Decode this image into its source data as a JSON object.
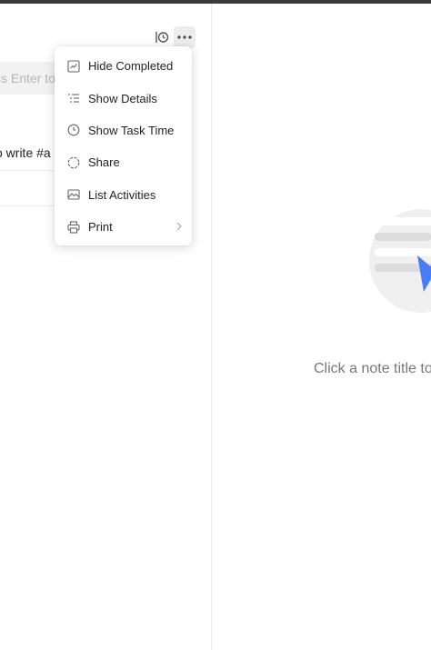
{
  "toolbar": {
    "focus_icon": "focus-clock-icon",
    "more_icon": "more-horizontal-icon"
  },
  "task_input": {
    "placeholder": "ss Enter to"
  },
  "tasks": [
    {
      "title": "o write #a"
    },
    {
      "title": ""
    }
  ],
  "menu": {
    "items": [
      {
        "label": "Hide Completed",
        "icon": "hide-completed-icon"
      },
      {
        "label": "Show Details",
        "icon": "details-list-icon"
      },
      {
        "label": "Show Task Time",
        "icon": "clock-icon"
      },
      {
        "label": "Share",
        "icon": "share-icon"
      },
      {
        "label": "List Activities",
        "icon": "activities-icon"
      },
      {
        "label": "Print",
        "icon": "printer-icon",
        "has_submenu": true
      }
    ]
  },
  "empty_state": {
    "text": "Click a note title to"
  },
  "colors": {
    "accent": "#4a7cf7",
    "top_bar": "#3a3a3a",
    "menu_shadow": "rgba(0,0,0,0.16)"
  }
}
